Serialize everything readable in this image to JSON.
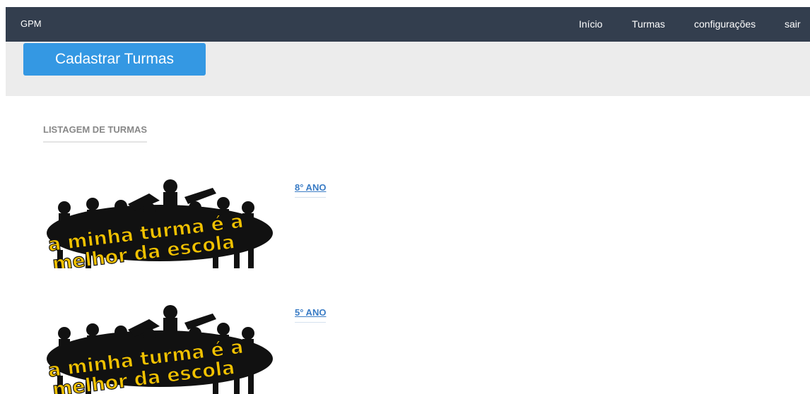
{
  "header": {
    "brand": "GPM",
    "nav": [
      "Início",
      "Turmas",
      "configurações",
      "sair"
    ]
  },
  "actions": {
    "cadastrar_label": "Cadastrar Turmas"
  },
  "listing": {
    "title": "LISTAGEM DE TURMAS",
    "turmas": [
      {
        "name": "8° ANO",
        "image_text_line1": "a minha turma é a",
        "image_text_line2": "melhor da escola"
      },
      {
        "name": "5° ANO",
        "image_text_line1": "a minha turma é a",
        "image_text_line2": "melhor da escola"
      }
    ]
  },
  "colors": {
    "topbar": "#333e4e",
    "button": "#3498e3",
    "link": "#3a7cc5",
    "banner_text": "#f2c200"
  }
}
